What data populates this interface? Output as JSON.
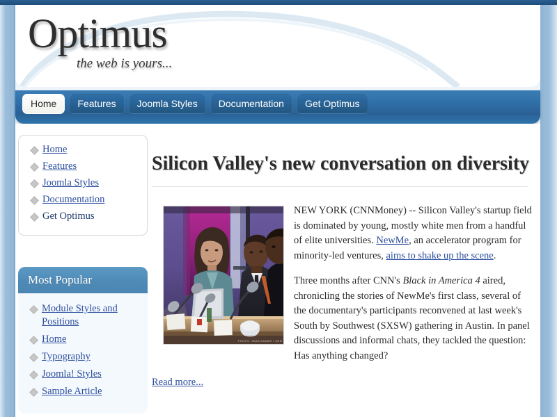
{
  "site": {
    "logo_title": "Optimus",
    "logo_tagline": "the web is yours..."
  },
  "nav": {
    "items": [
      {
        "label": "Home",
        "active": true
      },
      {
        "label": "Features",
        "active": false
      },
      {
        "label": "Joomla Styles",
        "active": false
      },
      {
        "label": "Documentation",
        "active": false
      },
      {
        "label": "Get Optimus",
        "active": false
      }
    ]
  },
  "sidebar": {
    "main_menu": {
      "items": [
        {
          "label": "Home",
          "current": false
        },
        {
          "label": "Features",
          "current": false
        },
        {
          "label": "Joomla Styles",
          "current": false
        },
        {
          "label": "Documentation",
          "current": false
        },
        {
          "label": "Get Optimus",
          "current": true
        }
      ]
    },
    "most_popular": {
      "title": "Most Popular",
      "items": [
        {
          "label": "Module Styles and Positions"
        },
        {
          "label": "Home"
        },
        {
          "label": "Typography"
        },
        {
          "label": "Joomla! Styles"
        },
        {
          "label": "Sample Article"
        }
      ]
    }
  },
  "article": {
    "title": "Silicon Valley's new conversation on diversity",
    "photo_credit": "PHOTO: JOAN ADAMS / CNN",
    "paragraph1": {
      "part1": "NEW YORK (CNNMoney) -- Silicon Valley's startup field is dominated by young, mostly white men from a handful of elite universities. ",
      "link1": "NewMe",
      "part2": ", an accelerator program for minority-led ventures, ",
      "link2": "aims to shake up the scene",
      "part3": "."
    },
    "paragraph2": {
      "part1": "Three months after CNN's ",
      "italic": "Black in America 4",
      "part2": " aired, chronicling the stories of NewMe's first class, several of the documentary's participants reconvened at last week's South by Southwest (SXSW) gathering in Austin. In panel discussions and informal chats, they tackled the question: Has anything changed?"
    },
    "read_more": "Read more..."
  },
  "colors": {
    "nav_blue": "#2f6ea6",
    "link_blue": "#2d4f9e",
    "module_header_blue": "#4f8ab6",
    "rail_blue": "#8fb4d4"
  }
}
